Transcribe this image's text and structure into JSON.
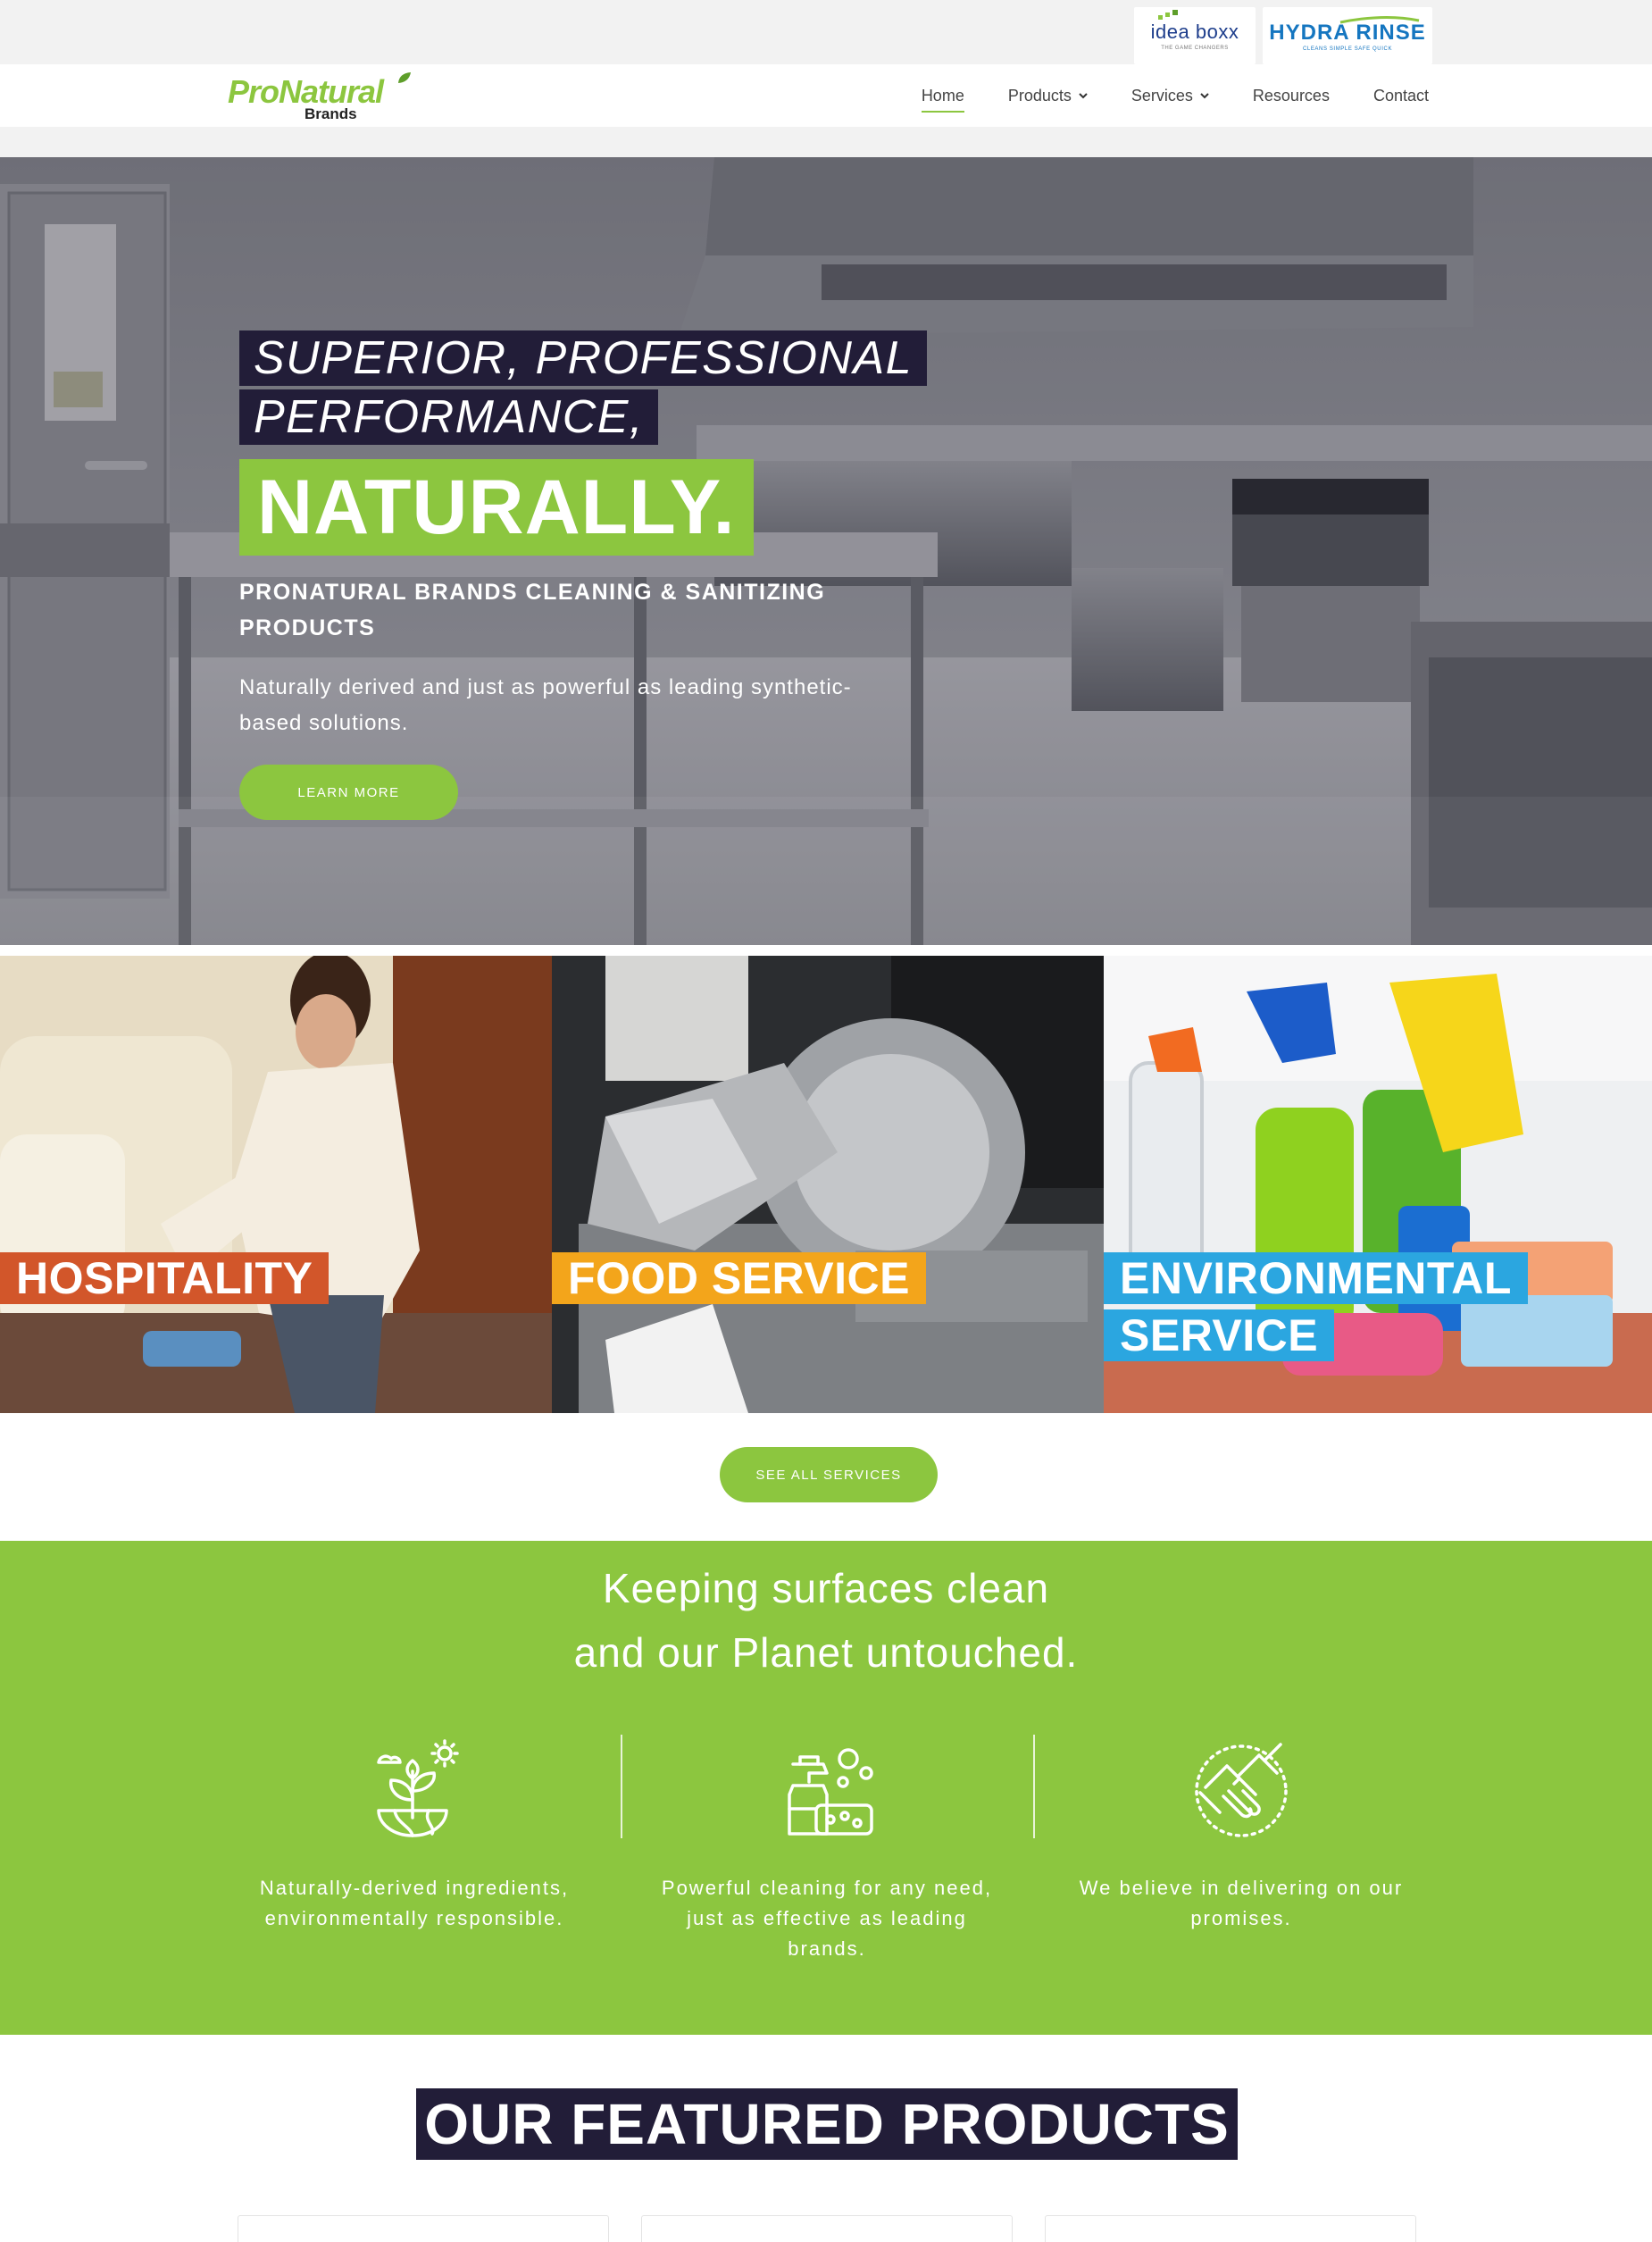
{
  "partners": {
    "idea_boxx": {
      "name": "idea boxx",
      "tagline": "THE GAME CHANGERS"
    },
    "hydra_rinse": {
      "name": "HYDRA RINSE",
      "tagline": "CLEANS SIMPLE SAFE QUICK"
    }
  },
  "logo": {
    "main_pro": "Pro",
    "main_natural": "Natural",
    "sub": "Brands"
  },
  "nav": {
    "items": [
      {
        "label": "Home",
        "active": true,
        "has_dropdown": false
      },
      {
        "label": "Products",
        "active": false,
        "has_dropdown": true
      },
      {
        "label": "Services",
        "active": false,
        "has_dropdown": true
      },
      {
        "label": "Resources",
        "active": false,
        "has_dropdown": false
      },
      {
        "label": "Contact",
        "active": false,
        "has_dropdown": false
      }
    ]
  },
  "hero": {
    "line1": "SUPERIOR, PROFESSIONAL",
    "line2": "PERFORMANCE,",
    "headline": "NATURALLY.",
    "subtitle": "PRONATURAL BRANDS CLEANING & SANITIZING PRODUCTS",
    "description": "Naturally derived and just as powerful as leading synthetic-based solutions.",
    "cta": "LEARN MORE"
  },
  "services": {
    "items": [
      {
        "label": "HOSPITALITY",
        "color": "#d2562a"
      },
      {
        "label_line1": "FOOD SERVICE",
        "color": "#f3a51b"
      },
      {
        "label_line1": "ENVIRONMENTAL",
        "label_line2": "SERVICE",
        "color": "#2ba6e0"
      }
    ],
    "cta": "SEE ALL SERVICES"
  },
  "mission": {
    "line1_a": "Keeping ",
    "line1_b": "surfaces",
    "line1_c": " clean",
    "line2_a": "and our ",
    "line2_b": "Planet",
    "line2_c": " untouched.",
    "features": [
      {
        "icon": "plant-globe-icon",
        "text": "Naturally-derived ingredients, environmentally responsible."
      },
      {
        "icon": "spray-sponge-icon",
        "text": "Powerful cleaning for any need, just as effective as leading brands."
      },
      {
        "icon": "handshake-icon",
        "text": "We believe in delivering on our promises."
      }
    ]
  },
  "featured": {
    "title": "OUR FEATURED PRODUCTS"
  },
  "colors": {
    "brand_green": "#8cc63f",
    "dark_navy": "#221d38",
    "hospitality": "#d2562a",
    "food_service": "#f3a51b",
    "environmental": "#2ba6e0"
  }
}
